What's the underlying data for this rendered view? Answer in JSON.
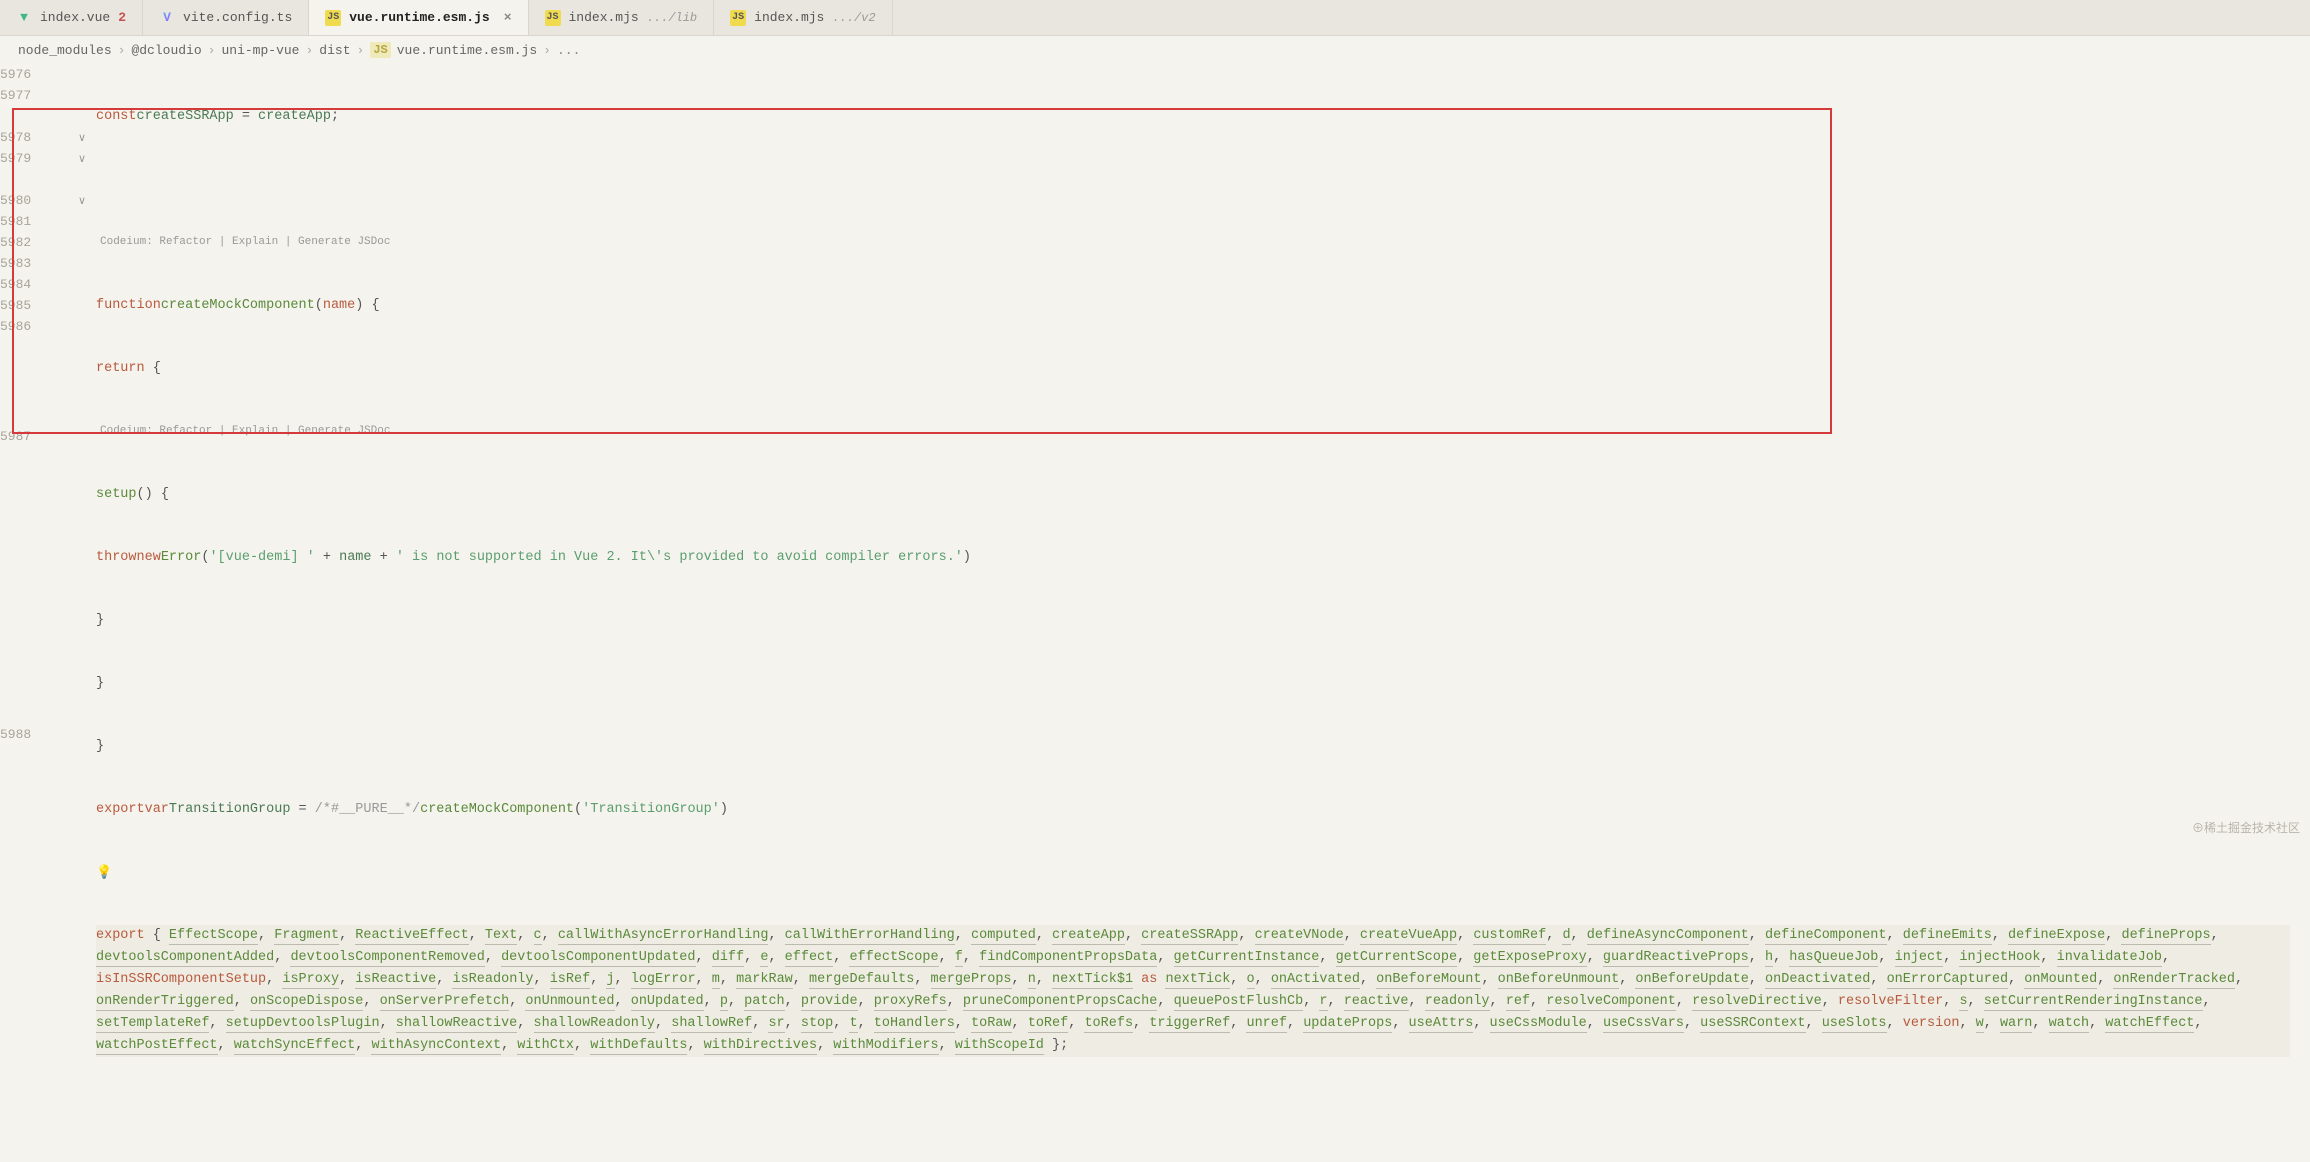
{
  "tabs": [
    {
      "label": "index.vue",
      "badge": "2",
      "icon": "vue"
    },
    {
      "label": "vite.config.ts",
      "icon": "vite"
    },
    {
      "label": "vue.runtime.esm.js",
      "icon": "js",
      "active": true,
      "close": true
    },
    {
      "label": "index.mjs",
      "hint": ".../lib",
      "icon": "js"
    },
    {
      "label": "index.mjs",
      "hint": ".../v2",
      "icon": "js"
    }
  ],
  "breadcrumbs": {
    "parts": [
      "node_modules",
      "@dcloudio",
      "uni-mp-vue",
      "dist"
    ],
    "file": "vue.runtime.esm.js",
    "tail": "..."
  },
  "gutter": [
    "5976",
    "5977",
    "",
    "5978",
    "5979",
    "",
    "5980",
    "5981",
    "5982",
    "5983",
    "5984",
    "5985",
    "5986",
    "5987",
    "",
    "",
    "",
    "",
    "",
    "",
    "",
    "",
    "",
    "5988"
  ],
  "fold": [
    "",
    "",
    "",
    "∨",
    "∨",
    "",
    "∨",
    "",
    "",
    "",
    "",
    "",
    "",
    "",
    "",
    "",
    "",
    "",
    "",
    "",
    "",
    "",
    "",
    ""
  ],
  "codelens": {
    "a": "Codeium: Refactor | Explain | Generate JSDoc",
    "b": "Codeium: Refactor | Explain | Generate JSDoc"
  },
  "code": {
    "l5976_kw": "const",
    "l5976_id": "createSSRApp",
    "l5976_eq": " = ",
    "l5976_rhs": "createApp",
    "l5976_semi": ";",
    "l5978_kw": "function",
    "l5978_fn": "createMockComponent",
    "l5978_open": "(",
    "l5978_param": "name",
    "l5978_close": ") {",
    "l5979_ret": "return",
    "l5979_brace": " {",
    "l5980_fn": "setup",
    "l5980_rest": "() {",
    "l5981_throw": "throw",
    "l5981_new": "new",
    "l5981_err": "Error",
    "l5981_open": "(",
    "l5981_s1": "'[vue-demi] '",
    "l5981_plus1": " + ",
    "l5981_name": "name",
    "l5981_plus2": " + ",
    "l5981_s2": "' is not supported in Vue 2. It\\'s provided to avoid compiler errors.'",
    "l5981_close": ")",
    "l5982": "}",
    "l5983": "}",
    "l5984": "}",
    "l5985_export": "export",
    "l5985_var": "var",
    "l5985_id": "TransitionGroup",
    "l5985_eq": " = ",
    "l5985_cmt": "/*#__PURE__*/",
    "l5985_fn": "createMockComponent",
    "l5985_open": "(",
    "l5985_str": "'TransitionGroup'",
    "l5985_close": ")",
    "l5987_export": "export",
    "l5987_open": " { ",
    "l5987_close": " };"
  },
  "exports": [
    "EffectScope",
    "Fragment",
    "ReactiveEffect",
    "Text",
    "c",
    "callWithAsyncErrorHandling",
    "callWithErrorHandling",
    "computed",
    "createApp",
    "createSSRApp",
    "createVNode",
    "createVueApp",
    "customRef",
    "d",
    "defineAsyncComponent",
    "defineComponent",
    "defineEmits",
    "defineExpose",
    "defineProps",
    "devtoolsComponentAdded",
    "devtoolsComponentRemoved",
    "devtoolsComponentUpdated",
    "diff",
    "e",
    "effect",
    "effectScope",
    "f",
    "findComponentPropsData",
    "getCurrentInstance",
    "getCurrentScope",
    "getExposeProxy",
    "guardReactiveProps",
    "h",
    "hasQueueJob",
    "inject",
    "injectHook",
    "invalidateJob",
    "isInSSRComponentSetup",
    "isProxy",
    "isReactive",
    "isReadonly",
    "isRef",
    "j",
    "logError",
    "m",
    "markRaw",
    "mergeDefaults",
    "mergeProps",
    "n",
    "nextTick$1 as nextTick",
    "o",
    "onActivated",
    "onBeforeMount",
    "onBeforeUnmount",
    "onBeforeUpdate",
    "onDeactivated",
    "onErrorCaptured",
    "onMounted",
    "onRenderTracked",
    "onRenderTriggered",
    "onScopeDispose",
    "onServerPrefetch",
    "onUnmounted",
    "onUpdated",
    "p",
    "patch",
    "provide",
    "proxyRefs",
    "pruneComponentPropsCache",
    "queuePostFlushCb",
    "r",
    "reactive",
    "readonly",
    "ref",
    "resolveComponent",
    "resolveDirective",
    "resolveFilter",
    "s",
    "setCurrentRenderingInstance",
    "setTemplateRef",
    "setupDevtoolsPlugin",
    "shallowReactive",
    "shallowReadonly",
    "shallowRef",
    "sr",
    "stop",
    "t",
    "toHandlers",
    "toRaw",
    "toRef",
    "toRefs",
    "triggerRef",
    "unref",
    "updateProps",
    "useAttrs",
    "useCssModule",
    "useCssVars",
    "useSSRContext",
    "useSlots",
    "version",
    "w",
    "warn",
    "watch",
    "watchEffect",
    "watchPostEffect",
    "watchSyncEffect",
    "withAsyncContext",
    "withCtx",
    "withDefaults",
    "withDirectives",
    "withModifiers",
    "withScopeId"
  ],
  "exports_missing": [
    "isInSSRComponentSetup",
    "resolveFilter",
    "version"
  ],
  "watermark": "⊕稀土掘金技术社区"
}
